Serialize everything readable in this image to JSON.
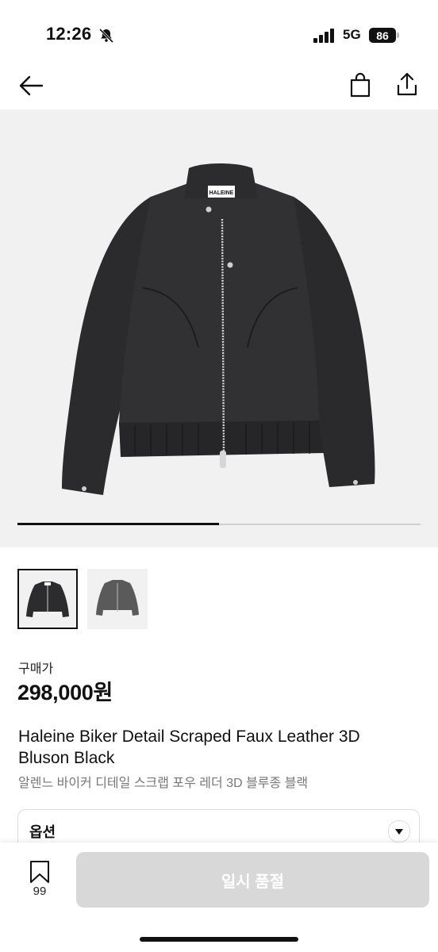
{
  "status_bar": {
    "time": "12:26",
    "network": "5G",
    "battery": "86"
  },
  "nav": {
    "back_icon": "arrow-left-icon",
    "bag_icon": "shopping-bag-icon",
    "share_icon": "share-icon"
  },
  "gallery": {
    "brand_tag": "HALEINE",
    "image_progress": 0.5,
    "thumbnails": [
      "black-jacket",
      "grey-jacket"
    ]
  },
  "product": {
    "price_label": "구매가",
    "price": "298,000원",
    "title": "Haleine Biker Detail Scraped Faux Leather 3D Bluson Black",
    "subtitle": "알렌느 바이커 디테일 스크랩 포우 레더 3D 블루종 블랙"
  },
  "options": {
    "label": "옵션"
  },
  "bottom": {
    "bookmark_count": "99",
    "cta_label": "일시 품절"
  },
  "colors": {
    "accent": "#111111",
    "disabled_button": "#d8d8d8",
    "hero_bg": "#f1f1f1"
  }
}
